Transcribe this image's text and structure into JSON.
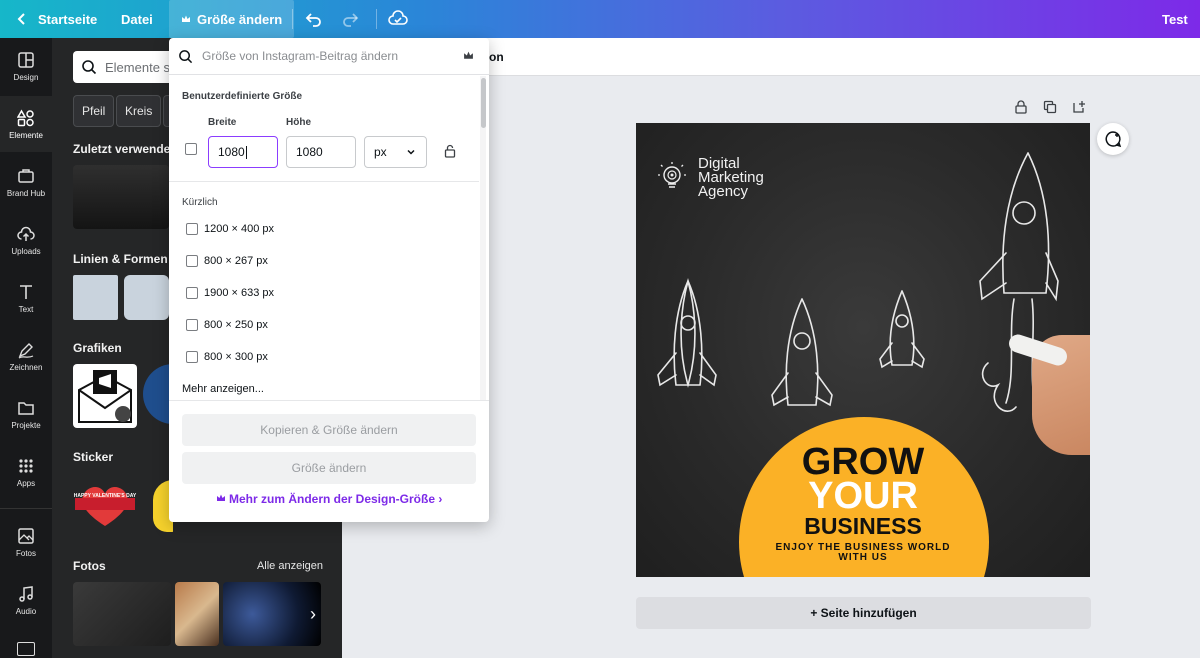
{
  "topbar": {
    "home_label": "Startseite",
    "file_label": "Datei",
    "resize_label": "Größe ändern",
    "user_label": "Test",
    "icons": [
      "chevron-left-icon",
      "crown-icon",
      "undo-icon",
      "redo-icon",
      "cloud-check-icon"
    ]
  },
  "rail": {
    "items": [
      {
        "label": "Design",
        "icon": "layout-icon"
      },
      {
        "label": "Elemente",
        "icon": "shapes-icon"
      },
      {
        "label": "Brand Hub",
        "icon": "briefcase-icon"
      },
      {
        "label": "Uploads",
        "icon": "cloud-upload-icon"
      },
      {
        "label": "Text",
        "icon": "text-icon"
      },
      {
        "label": "Zeichnen",
        "icon": "pen-icon"
      },
      {
        "label": "Projekte",
        "icon": "folder-icon"
      },
      {
        "label": "Apps",
        "icon": "grid-icon"
      },
      {
        "label": "Fotos",
        "icon": "image-icon"
      },
      {
        "label": "Audio",
        "icon": "music-icon"
      }
    ]
  },
  "panel": {
    "search_placeholder": "Elemente su",
    "chips": [
      "Pfeil",
      "Kreis"
    ],
    "recent_heading": "Zuletzt verwendet",
    "lines_heading": "Linien & Formen",
    "graphics_heading": "Grafiken",
    "sticker_heading": "Sticker",
    "photos_heading": "Fotos",
    "photos_link": "Alle anzeigen",
    "sticker_text": "HAPPY VALENTINE'S DAY"
  },
  "subbar": {
    "title_fragment": "on"
  },
  "design": {
    "brand": [
      "Digital",
      "Marketing",
      "Agency"
    ],
    "headline_1": "GROW",
    "headline_2": "YOUR",
    "headline_3": "BUSINESS",
    "tagline_1": "ENJOY THE BUSINESS WORLD",
    "tagline_2": "WITH US"
  },
  "add_page_label": "+ Seite hinzufügen",
  "dropdown": {
    "search_placeholder": "Größe von Instagram-Beitrag ändern",
    "custom_heading": "Benutzerdefinierte Größe",
    "width_label": "Breite",
    "height_label": "Höhe",
    "width_value": "1080",
    "height_value": "1080",
    "unit": "px",
    "recent_heading": "Kürzlich",
    "recent_sizes": [
      "1200 × 400 px",
      "800 × 267 px",
      "1900 × 633 px",
      "800 × 250 px",
      "800 × 300 px"
    ],
    "show_more": "Mehr anzeigen...",
    "copy_resize_label": "Kopieren & Größe ändern",
    "resize_label": "Größe ändern",
    "more_link": "Mehr zum Ändern der Design-Größe"
  },
  "colors": {
    "accent_purple": "#7d2ae8",
    "design_yellow": "#fbb126",
    "panel_dark": "#252627"
  }
}
